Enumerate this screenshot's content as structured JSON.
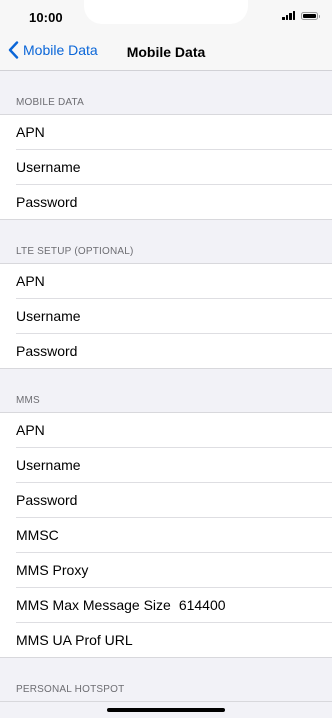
{
  "status_bar": {
    "time": "10:00"
  },
  "nav": {
    "back_label": "Mobile Data",
    "title": "Mobile Data"
  },
  "sections": [
    {
      "header": "MOBILE DATA",
      "rows": [
        {
          "label": "APN",
          "value": ""
        },
        {
          "label": "Username",
          "value": ""
        },
        {
          "label": "Password",
          "value": ""
        }
      ]
    },
    {
      "header": "LTE SETUP (OPTIONAL)",
      "rows": [
        {
          "label": "APN",
          "value": ""
        },
        {
          "label": "Username",
          "value": ""
        },
        {
          "label": "Password",
          "value": ""
        }
      ]
    },
    {
      "header": "MMS",
      "rows": [
        {
          "label": "APN",
          "value": ""
        },
        {
          "label": "Username",
          "value": ""
        },
        {
          "label": "Password",
          "value": ""
        },
        {
          "label": "MMSC",
          "value": ""
        },
        {
          "label": "MMS Proxy",
          "value": ""
        },
        {
          "label": "MMS Max Message Size",
          "value": "614400"
        },
        {
          "label": "MMS UA Prof URL",
          "value": ""
        }
      ]
    },
    {
      "header": "PERSONAL HOTSPOT"
    }
  ]
}
